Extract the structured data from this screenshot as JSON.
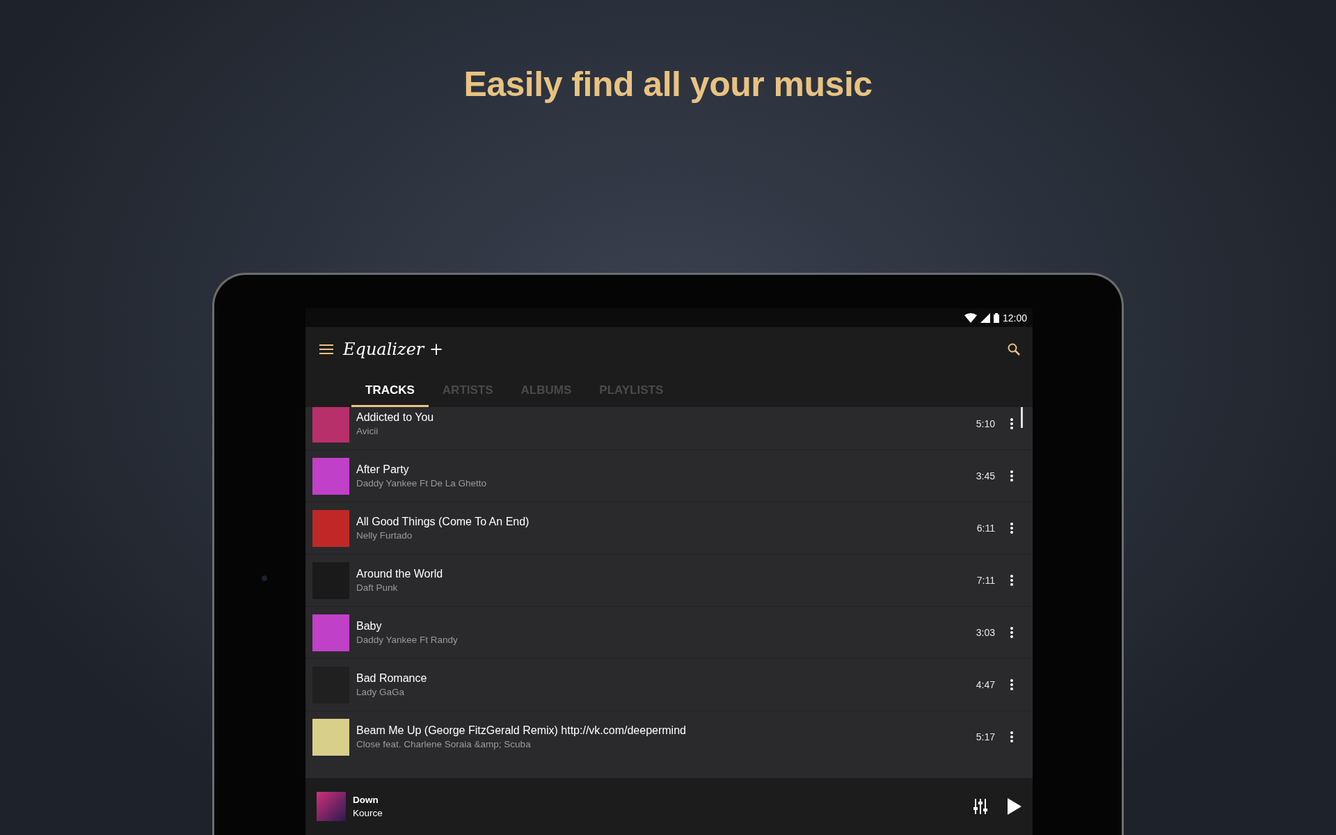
{
  "headline": "Easily find all your music",
  "status_bar": {
    "time": "12:00"
  },
  "app_bar": {
    "title": "Equalizer +"
  },
  "tabs": [
    {
      "label": "TRACKS",
      "selected": true
    },
    {
      "label": "ARTISTS",
      "selected": false
    },
    {
      "label": "ALBUMS",
      "selected": false
    },
    {
      "label": "PLAYLISTS",
      "selected": false
    }
  ],
  "tracks": [
    {
      "title": "Addicted to You",
      "artist": "Avicii",
      "duration": "5:10",
      "color": "#b8306a"
    },
    {
      "title": "After Party",
      "artist": "Daddy Yankee Ft De La Ghetto",
      "duration": "3:45",
      "color": "#c040c8"
    },
    {
      "title": "All Good Things (Come To An End)",
      "artist": "Nelly Furtado",
      "duration": "6:11",
      "color": "#c02828"
    },
    {
      "title": "Around the World",
      "artist": "Daft Punk",
      "duration": "7:11",
      "color": "#1a1a1a"
    },
    {
      "title": "Baby",
      "artist": "Daddy Yankee Ft Randy",
      "duration": "3:03",
      "color": "#c040c8"
    },
    {
      "title": "Bad Romance",
      "artist": "Lady GaGa",
      "duration": "4:47",
      "color": "#202020"
    },
    {
      "title": "Beam Me Up (George FitzGerald Remix) http://vk.com/deepermind",
      "artist": "Close feat. Charlene Soraia &amp; Scuba",
      "duration": "5:17",
      "color": "#d8cf8a"
    }
  ],
  "now_playing": {
    "title": "Down",
    "artist": "Kource"
  }
}
